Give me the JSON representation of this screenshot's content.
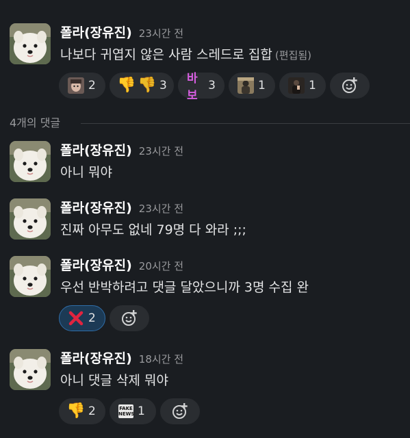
{
  "colors": {
    "background": "#1a1d21",
    "reaction_pill": "#2a2d31",
    "reaction_active_border": "#2f6da8",
    "baebo_text": "#d65ee0",
    "x_mark": "#e0243f"
  },
  "thread": {
    "parent": {
      "author": "폴라(장유진)",
      "time": "23시간 전",
      "text": "나보다 귀엽지 않은 사람 스레드로 집합",
      "edited": "(편집됨)",
      "reactions": [
        {
          "icon": "photo-face-icon",
          "count": "2"
        },
        {
          "icon": "thumbs-down-icon",
          "count": "3"
        },
        {
          "icon": "baebo-text-emoji",
          "label": "바보",
          "count": "3"
        },
        {
          "icon": "photo-person-icon",
          "count": "1"
        },
        {
          "icon": "photo-person-dark-icon",
          "count": "1"
        }
      ]
    },
    "reply_count_label": "4개의 댓글",
    "replies": [
      {
        "author": "폴라(장유진)",
        "time": "23시간 전",
        "text": "아니 뭐야"
      },
      {
        "author": "폴라(장유진)",
        "time": "23시간 전",
        "text": "진짜 아무도 없네 79명 다 와라 ;;;"
      },
      {
        "author": "폴라(장유진)",
        "time": "20시간 전",
        "text": "우선 반박하려고 댓글 달았으니까 3명 수집 완",
        "reactions": [
          {
            "icon": "x-mark-icon",
            "count": "2"
          }
        ]
      },
      {
        "author": "폴라(장유진)",
        "time": "18시간 전",
        "text": "아니 댓글 삭제 뭐야",
        "reactions": [
          {
            "icon": "thumbs-down-icon",
            "count": "2"
          },
          {
            "icon": "fake-news-icon",
            "label_top": "FAKE",
            "label_bottom": "NEWS",
            "count": "1"
          }
        ]
      }
    ]
  }
}
